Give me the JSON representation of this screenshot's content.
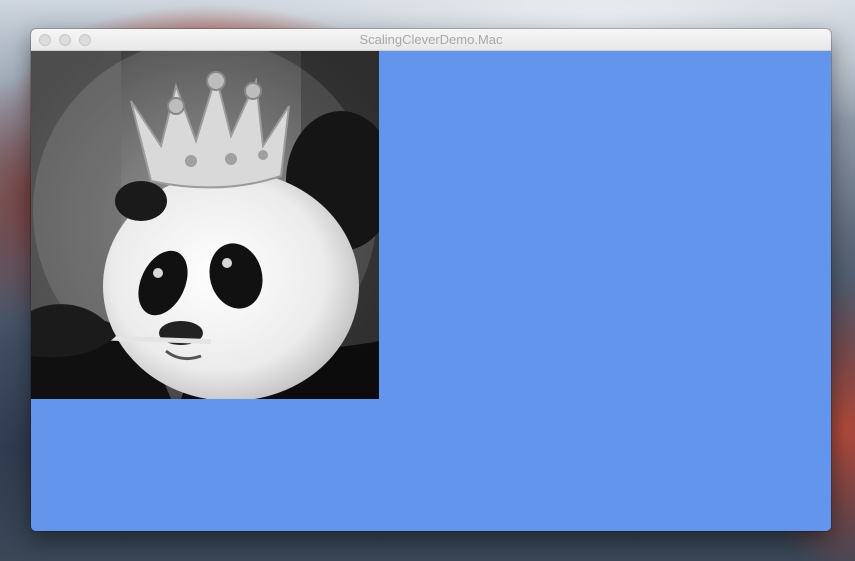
{
  "window": {
    "title": "ScalingCleverDemo.Mac"
  },
  "content": {
    "background_color": "#6495ed",
    "image": {
      "subject": "panda wearing a crown"
    }
  },
  "icons": {
    "close": "close-button",
    "minimize": "minimize-button",
    "zoom": "zoom-button"
  }
}
